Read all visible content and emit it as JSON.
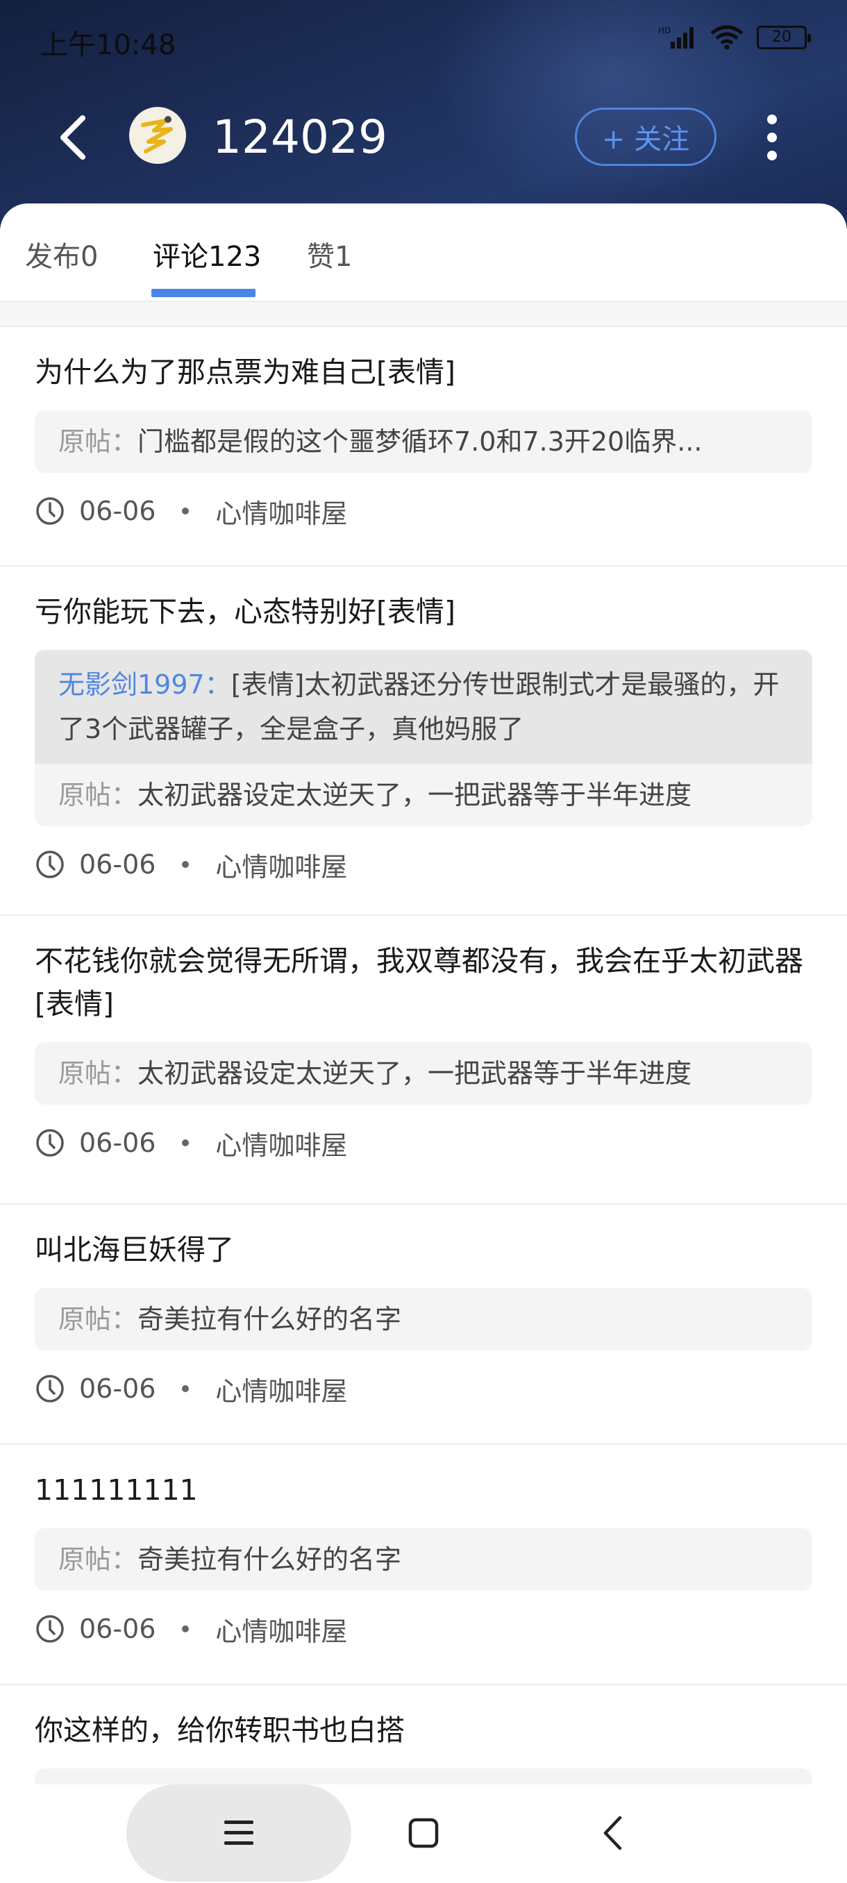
{
  "status_bar": {
    "time": "上午10:48",
    "network": "HD",
    "battery": "20"
  },
  "header": {
    "user_name": "124029",
    "follow_label": "+ 关注"
  },
  "tabs": [
    {
      "label": "发布0"
    },
    {
      "label": "评论123"
    },
    {
      "label": "赞1"
    }
  ],
  "comments": [
    {
      "text": "为什么为了那点票为难自己[表情]",
      "original_label": "原帖：",
      "original": "门槛都是假的这个噩梦循环7.0和7.3开20临界...",
      "date": "06-06",
      "forum": "心情咖啡屋"
    },
    {
      "text": "亏你能玩下去，心态特别好[表情]",
      "reply_author": "无影剑1997：",
      "reply_text": "[表情]太初武器还分传世跟制式才是最骚的，开了3个武器罐子，全是盒子，真他妈服了",
      "original_label": "原帖：",
      "original": "太初武器设定太逆天了，一把武器等于半年进度",
      "date": "06-06",
      "forum": "心情咖啡屋"
    },
    {
      "text": "不花钱你就会觉得无所谓，我双尊都没有，我会在乎太初武器[表情]",
      "original_label": "原帖：",
      "original": "太初武器设定太逆天了，一把武器等于半年进度",
      "date": "06-06",
      "forum": "心情咖啡屋"
    },
    {
      "text": "叫北海巨妖得了",
      "original_label": "原帖：",
      "original": "奇美拉有什么好的名字",
      "date": "06-06",
      "forum": "心情咖啡屋"
    },
    {
      "text": "111111111",
      "original_label": "原帖：",
      "original": "奇美拉有什么好的名字",
      "date": "06-06",
      "forum": "心情咖啡屋"
    },
    {
      "text": "你这样的，给你转职书也白搭"
    }
  ],
  "colors": {
    "accent": "#4a86e8",
    "header_bg": "#1c2c55",
    "link": "#4f86e0"
  }
}
